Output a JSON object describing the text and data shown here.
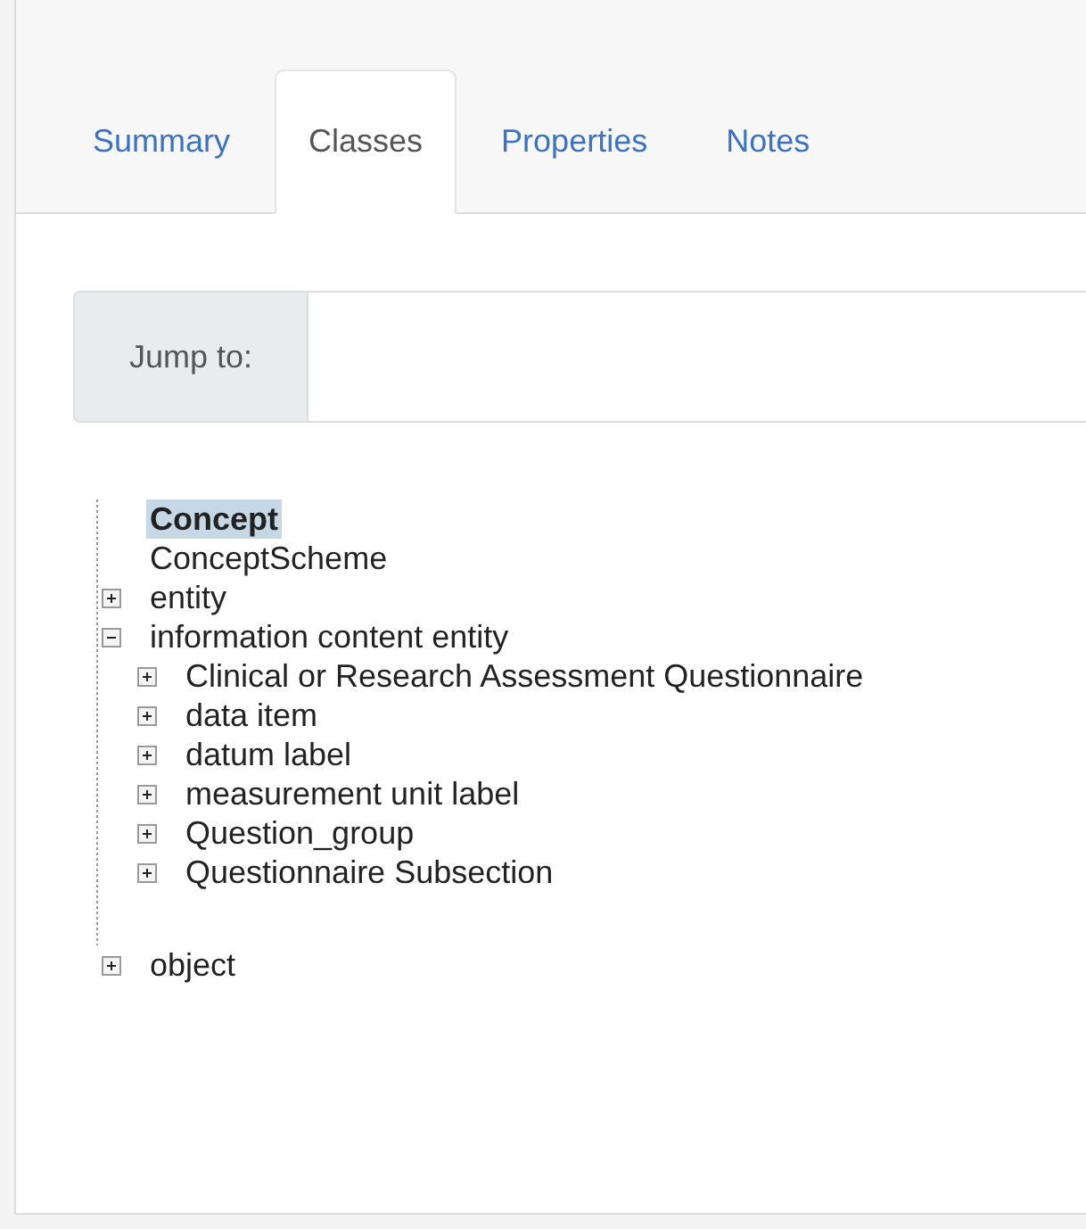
{
  "tabs": [
    {
      "label": "Summary",
      "selected": false
    },
    {
      "label": "Classes",
      "selected": true
    },
    {
      "label": "Properties",
      "selected": false
    },
    {
      "label": "Notes",
      "selected": false
    }
  ],
  "jump": {
    "label": "Jump to:"
  },
  "tree": [
    {
      "label": "Concept",
      "kind": "leaf",
      "selected": true
    },
    {
      "label": "ConceptScheme",
      "kind": "leaf",
      "selected": false
    },
    {
      "label": "entity",
      "kind": "branch",
      "expanded": false,
      "selected": false
    },
    {
      "label": "information content entity",
      "kind": "branch",
      "expanded": true,
      "selected": false,
      "children": [
        {
          "label": "Clinical or Research Assessment Questionnaire",
          "kind": "branch",
          "expanded": false,
          "selected": false
        },
        {
          "label": "data item",
          "kind": "branch",
          "expanded": false,
          "selected": false
        },
        {
          "label": "datum label",
          "kind": "branch",
          "expanded": false,
          "selected": false
        },
        {
          "label": "measurement unit label",
          "kind": "branch",
          "expanded": false,
          "selected": false
        },
        {
          "label": "Question_group",
          "kind": "branch",
          "expanded": false,
          "selected": false
        },
        {
          "label": "Questionnaire Subsection",
          "kind": "branch",
          "expanded": false,
          "selected": false
        }
      ]
    },
    {
      "label": "object",
      "kind": "branch",
      "expanded": false,
      "selected": false
    }
  ]
}
